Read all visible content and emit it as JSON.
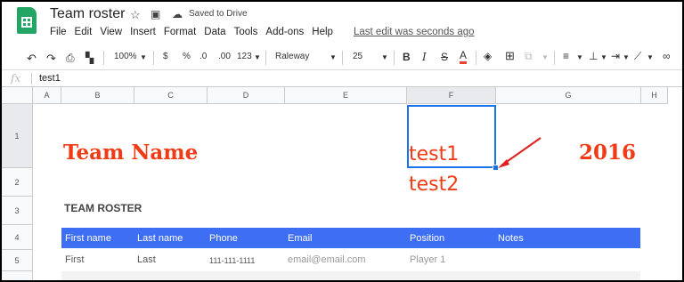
{
  "app": {
    "title": "Team roster",
    "saved_status": "Saved to Drive",
    "last_edit": "Last edit was seconds ago"
  },
  "menu": [
    "File",
    "Edit",
    "View",
    "Insert",
    "Format",
    "Data",
    "Tools",
    "Add-ons",
    "Help"
  ],
  "toolbar": {
    "zoom": "100%",
    "currency": "$",
    "percent": "%",
    "decimal_less": ".0",
    "decimal_more": ".00",
    "more_formats": "123",
    "font": "Raleway",
    "font_size": "25",
    "bold": "B",
    "italic": "I",
    "strike": "S",
    "text_color_letter": "A",
    "text_color": "#ea4335"
  },
  "formula_bar": {
    "fx": "fx",
    "value": "test1"
  },
  "columns": [
    "A",
    "B",
    "C",
    "D",
    "E",
    "F",
    "G",
    "H"
  ],
  "rows": [
    "1",
    "2",
    "3",
    "4",
    "5"
  ],
  "sheet": {
    "team_name": "Team Name",
    "year": "2016",
    "cell_f1": "test1",
    "overflow_text": "test2",
    "roster_title": "TEAM ROSTER",
    "headers": [
      "First name",
      "Last name",
      "Phone",
      "Email",
      "Position",
      "Notes"
    ],
    "row": [
      "First",
      "Last",
      "111-111-1111",
      "email@email.com",
      "Player 1"
    ]
  },
  "colors": {
    "accent_red": "#ef3b16",
    "header_blue": "#3e6ef3",
    "selection_blue": "#1a73e8",
    "sheets_green": "#23a566"
  }
}
